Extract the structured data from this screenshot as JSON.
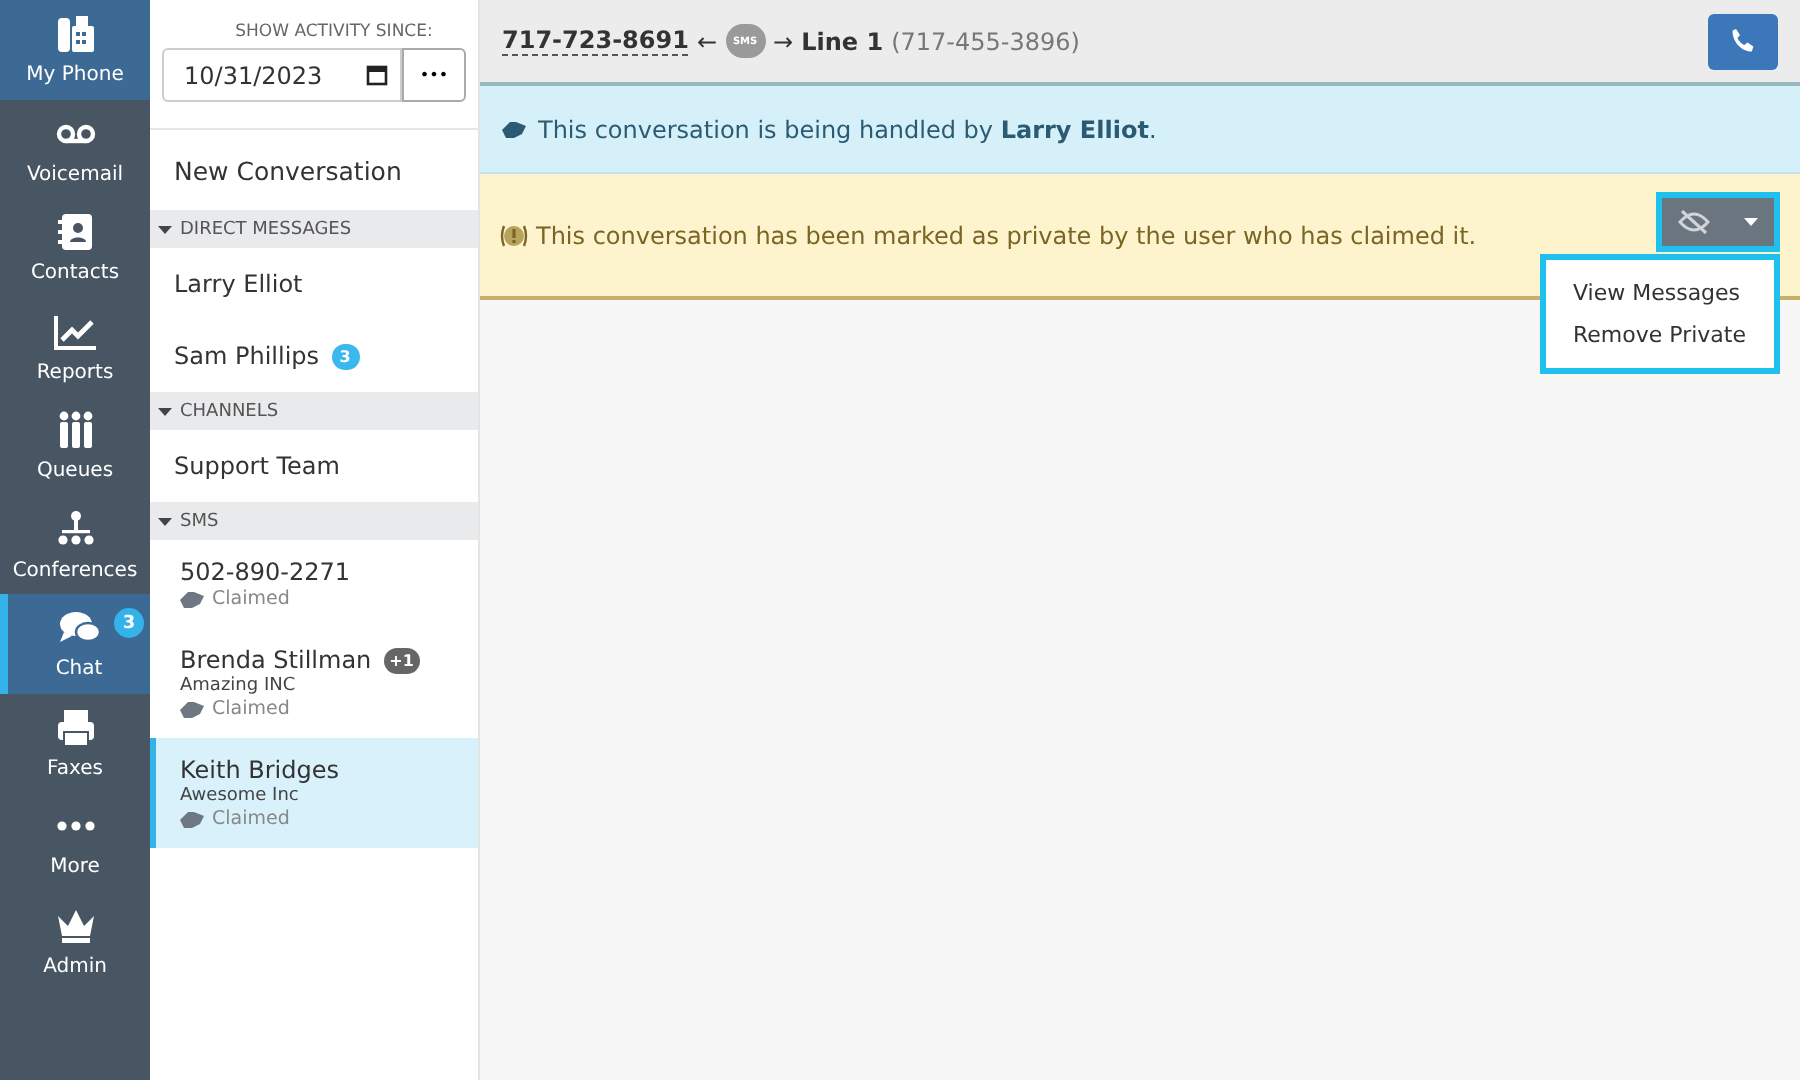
{
  "nav": [
    {
      "label": "My Phone",
      "kind": "home",
      "selected": false
    },
    {
      "label": "Voicemail",
      "kind": "nav",
      "selected": false
    },
    {
      "label": "Contacts",
      "kind": "nav",
      "selected": false
    },
    {
      "label": "Reports",
      "kind": "nav",
      "selected": false
    },
    {
      "label": "Queues",
      "kind": "nav",
      "selected": false
    },
    {
      "label": "Conferences",
      "kind": "nav",
      "selected": false
    },
    {
      "label": "Chat",
      "kind": "nav",
      "selected": true,
      "badge": "3"
    },
    {
      "label": "Faxes",
      "kind": "nav",
      "selected": false
    },
    {
      "label": "More",
      "kind": "nav",
      "selected": false
    },
    {
      "label": "Admin",
      "kind": "nav",
      "selected": false
    }
  ],
  "filter": {
    "label": "SHOW ACTIVITY SINCE:",
    "date": "10/31/2023",
    "more_button": "•••"
  },
  "new_conversation": "New Conversation",
  "sections": [
    {
      "title": "DIRECT MESSAGES",
      "expanded": true,
      "items": [
        {
          "name": "Larry Elliot",
          "selected": false
        },
        {
          "name": "Sam Phillips",
          "selected": false,
          "badge": {
            "text": "3",
            "color": "#3bb9ef"
          }
        }
      ]
    },
    {
      "title": "CHANNELS",
      "expanded": true,
      "items": [
        {
          "name": "Support Team",
          "selected": false
        }
      ]
    },
    {
      "title": "SMS",
      "expanded": true,
      "items": [
        {
          "name": "502-890-2271",
          "selected": false,
          "status": "Claimed"
        },
        {
          "name": "Brenda Stillman",
          "selected": false,
          "badge": {
            "text": "+1",
            "color": "#666666"
          },
          "company": "Amazing INC",
          "status": "Claimed"
        },
        {
          "name": "Keith Bridges",
          "selected": true,
          "company": "Awesome Inc",
          "status": "Claimed"
        }
      ]
    }
  ],
  "header": {
    "from": "717-723-8691",
    "arrow_in": "←",
    "channel": "SMS",
    "arrow_out": "→",
    "line": "Line 1",
    "line_number": "(717-455-3896)"
  },
  "info_banner": "This conversation is being handled by **Larry Elliot**.",
  "private_banner": {
    "text": "This conversation has been marked as private by the user who has claimed it.",
    "menu_open": true,
    "menu": [
      "View Messages",
      "Remove Private"
    ]
  }
}
